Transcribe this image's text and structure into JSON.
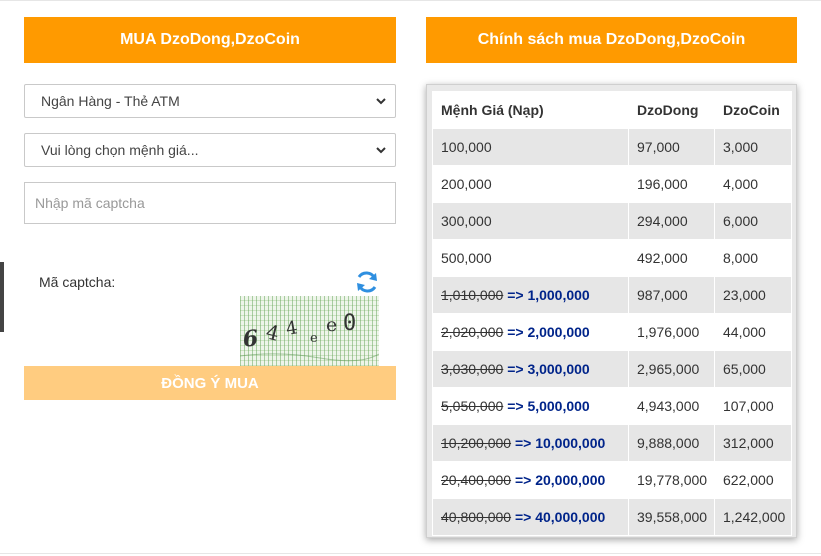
{
  "buy_form": {
    "header": "MUA DzoDong,DzoCoin",
    "payment_method": "Ngân Hàng - Thẻ ATM",
    "denomination_placeholder": "Vui lòng chọn mệnh giá...",
    "captcha_placeholder": "Nhập mã captcha",
    "captcha_label": "Mã captcha:",
    "submit_label": "ĐỒNG Ý MUA",
    "captcha_image_text": "674e0"
  },
  "policy": {
    "header": "Chính sách mua DzoDong,DzoCoin",
    "columns": [
      "Mệnh Giá (Nạp)",
      "DzoDong",
      "DzoCoin"
    ],
    "rows": [
      {
        "old": "",
        "value": "100,000",
        "dzodong": "97,000",
        "dzocoin": "3,000"
      },
      {
        "old": "",
        "value": "200,000",
        "dzodong": "196,000",
        "dzocoin": "4,000"
      },
      {
        "old": "",
        "value": "300,000",
        "dzodong": "294,000",
        "dzocoin": "6,000"
      },
      {
        "old": "",
        "value": "500,000",
        "dzodong": "492,000",
        "dzocoin": "8,000"
      },
      {
        "old": "1,010,000",
        "value": "1,000,000",
        "dzodong": "987,000",
        "dzocoin": "23,000"
      },
      {
        "old": "2,020,000",
        "value": "2,000,000",
        "dzodong": "1,976,000",
        "dzocoin": "44,000"
      },
      {
        "old": "3,030,000",
        "value": "3,000,000",
        "dzodong": "2,965,000",
        "dzocoin": "65,000"
      },
      {
        "old": "5,050,000",
        "value": "5,000,000",
        "dzodong": "4,943,000",
        "dzocoin": "107,000"
      },
      {
        "old": "10,200,000",
        "value": "10,000,000",
        "dzodong": "9,888,000",
        "dzocoin": "312,000"
      },
      {
        "old": "20,400,000",
        "value": "20,000,000",
        "dzodong": "19,778,000",
        "dzocoin": "622,000"
      },
      {
        "old": "40,800,000",
        "value": "40,000,000",
        "dzodong": "39,558,000",
        "dzocoin": "1,242,000"
      }
    ],
    "arrow": "=>"
  },
  "colors": {
    "accent": "#ff9a00",
    "submit_disabled": "#ffcc80",
    "discount_text": "#00248a",
    "refresh_icon": "#2f8fe0"
  },
  "icons": {
    "select_chevron": "chevron-down-icon",
    "refresh": "refresh-icon"
  }
}
